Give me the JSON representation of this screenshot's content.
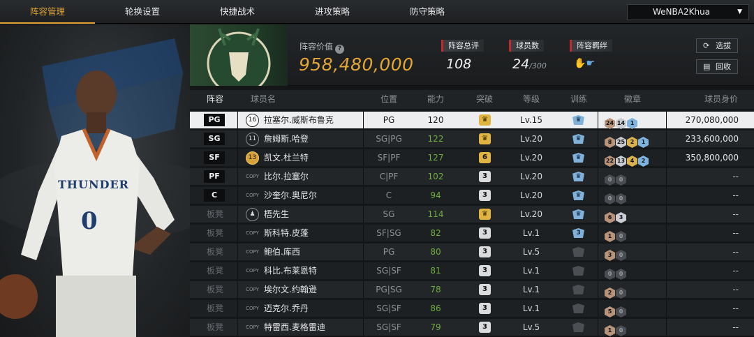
{
  "nav": {
    "tabs": [
      "阵容管理",
      "轮换设置",
      "快捷战术",
      "进攻策略",
      "防守策略"
    ],
    "active": 0,
    "user": "WeNBA2Khua"
  },
  "header": {
    "value_label": "阵容价值",
    "value": "958,480,000",
    "overall_label": "阵容总评",
    "overall": "108",
    "players_label": "球员数",
    "players": "24",
    "players_max": "/300",
    "chem_label": "阵容羁绊",
    "btn_select": "选拔",
    "btn_recycle": "回收"
  },
  "columns": [
    "阵容",
    "球员名",
    "位置",
    "能力",
    "突破",
    "等级",
    "训练",
    "徽章",
    "球员身价"
  ],
  "rows": [
    {
      "slot": "PG",
      "bench": false,
      "no": "16",
      "name": "拉塞尔.威斯布鲁克",
      "pos": "PG",
      "ovr": "120",
      "green": false,
      "brk": "crown",
      "lv": "Lv.15",
      "train": "",
      "badges": [
        [
          "b",
          "24"
        ],
        [
          "s",
          "14"
        ],
        [
          "bl",
          "1"
        ]
      ],
      "price": "270,080,000",
      "sel": true
    },
    {
      "slot": "SG",
      "bench": false,
      "no": "11",
      "name": "詹姆斯.哈登",
      "pos": "SG|PG",
      "ovr": "122",
      "green": true,
      "brk": "crown",
      "lv": "Lv.20",
      "train": "",
      "badges": [
        [
          "b",
          "8"
        ],
        [
          "s",
          "25"
        ],
        [
          "go",
          "2"
        ],
        [
          "bl",
          "1"
        ]
      ],
      "price": "233,600,000"
    },
    {
      "slot": "SF",
      "bench": false,
      "no": "13",
      "name": "凯文.杜兰特",
      "pos": "SF|PF",
      "ovr": "127",
      "green": true,
      "brk": "6",
      "lv": "Lv.20",
      "train": "",
      "badges": [
        [
          "b",
          "22"
        ],
        [
          "s",
          "13"
        ],
        [
          "go",
          "4"
        ],
        [
          "bl",
          "2"
        ]
      ],
      "price": "350,800,000",
      "gold": true
    },
    {
      "slot": "PF",
      "bench": false,
      "no": "COPY",
      "name": "比尔.拉塞尔",
      "pos": "C|PF",
      "ovr": "102",
      "green": true,
      "brk": "3",
      "lv": "Lv.20",
      "train": "",
      "badges": [
        [
          "d",
          "0"
        ],
        [
          "d",
          "0"
        ]
      ],
      "price": "--"
    },
    {
      "slot": "C",
      "bench": false,
      "no": "COPY",
      "name": "沙奎尔.奥尼尔",
      "pos": "C",
      "ovr": "94",
      "green": true,
      "brk": "3",
      "lv": "Lv.20",
      "train": "",
      "badges": [
        [
          "d",
          "0"
        ],
        [
          "d",
          "0"
        ]
      ],
      "price": "--"
    },
    {
      "slot": "板凳",
      "bench": true,
      "no": "",
      "name": "梧先生",
      "pos": "SG",
      "ovr": "114",
      "green": true,
      "brk": "crown",
      "lv": "Lv.20",
      "train": "",
      "badges": [
        [
          "b",
          "6"
        ],
        [
          "s",
          "3"
        ]
      ],
      "price": "--"
    },
    {
      "slot": "板凳",
      "bench": true,
      "no": "COPY",
      "name": "斯科特.皮蓬",
      "pos": "SF|SG",
      "ovr": "82",
      "green": true,
      "brk": "3",
      "lv": "Lv.1",
      "train": "3",
      "badges": [
        [
          "b",
          "1"
        ],
        [
          "d",
          "0"
        ]
      ],
      "price": "--"
    },
    {
      "slot": "板凳",
      "bench": true,
      "no": "COPY",
      "name": "鲍伯.库西",
      "pos": "PG",
      "ovr": "80",
      "green": true,
      "brk": "3",
      "lv": "Lv.5",
      "train": "dark",
      "badges": [
        [
          "b",
          "3"
        ],
        [
          "d",
          "0"
        ]
      ],
      "price": "--"
    },
    {
      "slot": "板凳",
      "bench": true,
      "no": "COPY",
      "name": "科比.布莱恩特",
      "pos": "SG|SF",
      "ovr": "81",
      "green": true,
      "brk": "3",
      "lv": "Lv.1",
      "train": "dark",
      "badges": [
        [
          "d",
          "0"
        ],
        [
          "d",
          "0"
        ]
      ],
      "price": "--"
    },
    {
      "slot": "板凳",
      "bench": true,
      "no": "COPY",
      "name": "埃尔文.约翰逊",
      "pos": "PG|SG",
      "ovr": "78",
      "green": true,
      "brk": "3",
      "lv": "Lv.1",
      "train": "dark",
      "badges": [
        [
          "b",
          "2"
        ],
        [
          "d",
          "0"
        ]
      ],
      "price": "--"
    },
    {
      "slot": "板凳",
      "bench": true,
      "no": "COPY",
      "name": "迈克尔.乔丹",
      "pos": "SG|SF",
      "ovr": "86",
      "green": true,
      "brk": "3",
      "lv": "Lv.1",
      "train": "dark",
      "badges": [
        [
          "b",
          "5"
        ],
        [
          "d",
          "0"
        ]
      ],
      "price": "--"
    },
    {
      "slot": "板凳",
      "bench": true,
      "no": "COPY",
      "name": "特雷西.麦格雷迪",
      "pos": "SG|SF",
      "ovr": "79",
      "green": true,
      "brk": "3",
      "lv": "Lv.5",
      "train": "dark",
      "badges": [
        [
          "b",
          "1"
        ],
        [
          "d",
          "0"
        ]
      ],
      "price": "--"
    }
  ],
  "colors": {
    "accent": "#e0a334",
    "green": "#6fae3e",
    "red": "#c22b2b",
    "badge_blue": "#7fb1d9"
  }
}
